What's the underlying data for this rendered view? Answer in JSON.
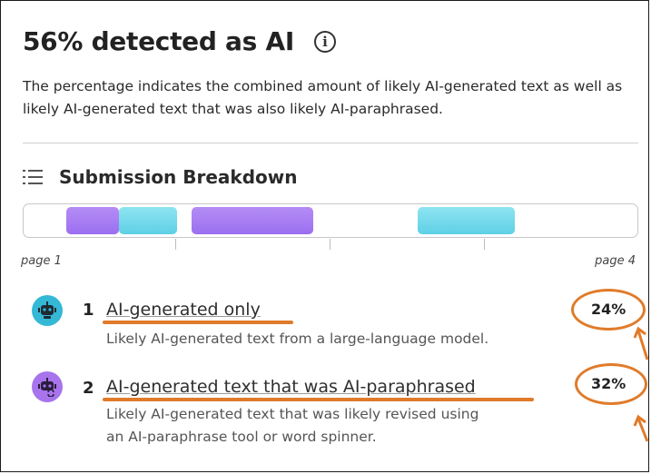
{
  "header": {
    "title": "56% detected as AI",
    "info_icon": "info-icon",
    "description": "The percentage indicates the combined amount of likely AI-generated text as well as likely AI-generated text that was also likely AI-paraphrased."
  },
  "breakdown": {
    "icon": "list-icon",
    "title": "Submission Breakdown",
    "start_label": "page 1",
    "end_label": "page 4",
    "segments": [
      {
        "kind": "ai",
        "start": 0.07,
        "end": 0.155
      },
      {
        "kind": "para",
        "start": 0.155,
        "end": 0.25
      },
      {
        "kind": "ai",
        "start": 0.273,
        "end": 0.472
      },
      {
        "kind": "para",
        "start": 0.642,
        "end": 0.8
      }
    ]
  },
  "items": [
    {
      "number": "1",
      "label": "AI-generated only",
      "description": "Likely AI-generated text from a large-language model.",
      "percent": "24%",
      "icon": "robot-icon",
      "color": "#35b8d6"
    },
    {
      "number": "2",
      "label": "AI-generated text that was AI-paraphrased",
      "description_line1": "Likely AI-generated text that was likely revised using",
      "description_line2": "an AI-paraphrase tool or word spinner.",
      "percent": "32%",
      "icon": "robot-paraphrase-icon",
      "color": "#a774ec"
    }
  ],
  "colors": {
    "ai_segment": "#9b6ff0",
    "paraphrase_segment": "#5ed0e6",
    "annotation": "#e07b2a"
  }
}
